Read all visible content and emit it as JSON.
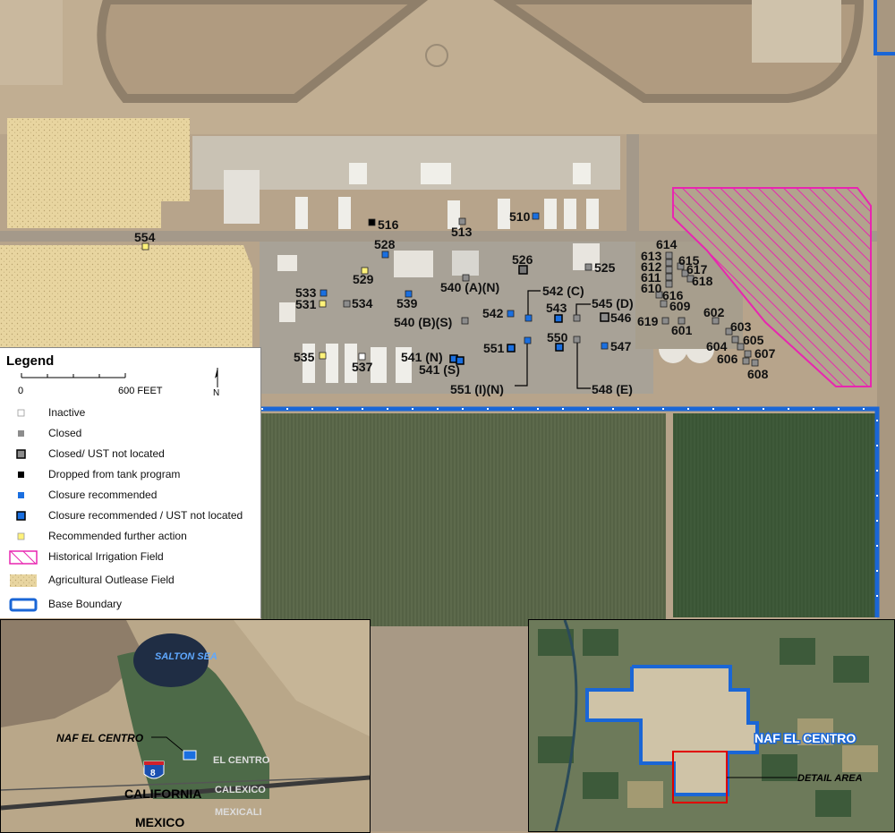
{
  "site_labels": {
    "s510": "510",
    "s513": "513",
    "s516": "516",
    "s525": "525",
    "s526": "526",
    "s528": "528",
    "s529": "529",
    "s531": "531",
    "s533": "533",
    "s534": "534",
    "s535": "535",
    "s537": "537",
    "s539": "539",
    "s540a": "540 (A)(N)",
    "s540b": "540 (B)(S)",
    "s541n": "541 (N)",
    "s541s": "541 (S)",
    "s542": "542",
    "s542c": "542 (C)",
    "s543": "543",
    "s545d": "545 (D)",
    "s546": "546",
    "s547": "547",
    "s548e": "548 (E)",
    "s550": "550",
    "s551": "551",
    "s551in": "551 (I)(N)",
    "s554": "554",
    "s601": "601",
    "s602": "602",
    "s603": "603",
    "s604": "604",
    "s605": "605",
    "s606": "606",
    "s607": "607",
    "s608": "608",
    "s609": "609",
    "s610": "610",
    "s611": "611",
    "s612": "612",
    "s613": "613",
    "s614": "614",
    "s615": "615",
    "s616": "616",
    "s617": "617",
    "s618": "618",
    "s619": "619"
  },
  "legend": {
    "title": "Legend",
    "scale_zero": "0",
    "scale_end": "600 FEET",
    "north": "N",
    "items": [
      {
        "label": "Inactive",
        "color": "#ffffff"
      },
      {
        "label": "Closed",
        "color": "#8c8c8c"
      },
      {
        "label": "Closed/ UST not located",
        "color": "#8c8c8c"
      },
      {
        "label": "Dropped from tank program",
        "color": "#000000"
      },
      {
        "label": "Closure recommended",
        "color": "#1a6fe0"
      },
      {
        "label": "Closure recommended / UST not located",
        "color": "#1a6fe0"
      },
      {
        "label": "Recommended further action",
        "color": "#fff27a"
      },
      {
        "label": "Historical Irrigation Field",
        "color": "#e826b0"
      },
      {
        "label": "Agricultural Outlease Field",
        "color": "#e8d5a0"
      },
      {
        "label": "Base Boundary",
        "color": "#1a66d6"
      }
    ]
  },
  "inset_regional": {
    "salton_sea": "SALTON SEA",
    "naf": "NAF EL CENTRO",
    "el_centro": "EL CENTRO",
    "calexico": "CALEXICO",
    "mexicali": "MEXICALI",
    "california": "CALIFORNIA",
    "mexico": "MEXICO",
    "interstate": "8"
  },
  "inset_base": {
    "naf": "NAF EL CENTRO",
    "detail": "DETAIL AREA"
  }
}
